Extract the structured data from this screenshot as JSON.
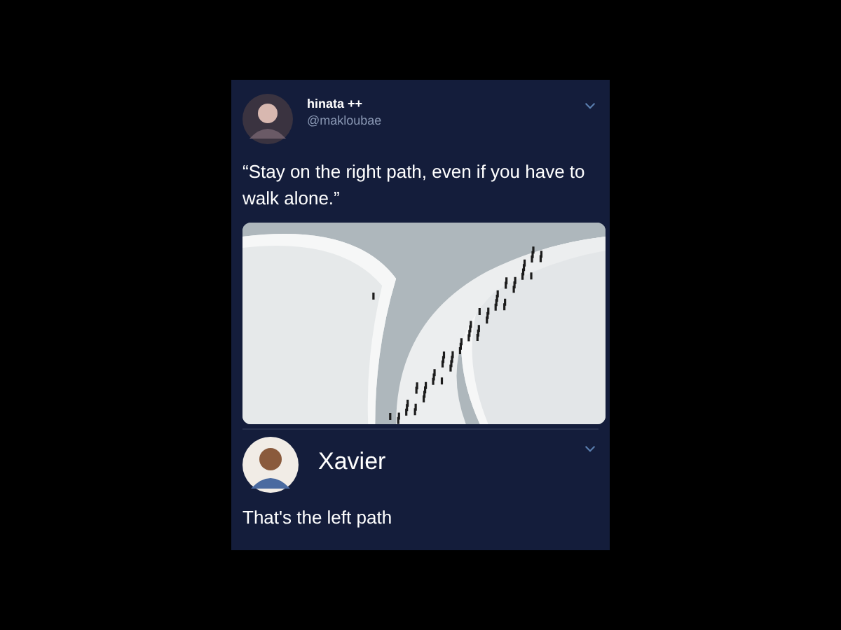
{
  "tweet": {
    "name": "hinata ++",
    "handle": "@makloubae",
    "text": "“Stay on the right path, even if you have to walk alone.”"
  },
  "reply": {
    "name": "Xavier",
    "text": "That's the left path"
  }
}
